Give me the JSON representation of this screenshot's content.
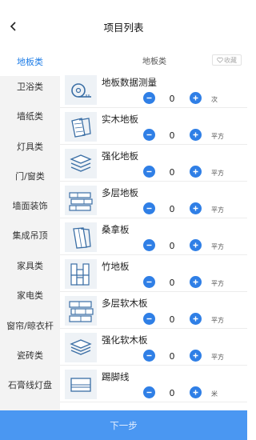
{
  "header": {
    "title": "项目列表"
  },
  "sidebar": {
    "items": [
      {
        "label": "地板类"
      },
      {
        "label": "卫浴类"
      },
      {
        "label": "墙纸类"
      },
      {
        "label": "灯具类"
      },
      {
        "label": "门/窗类"
      },
      {
        "label": "墙面装饰"
      },
      {
        "label": "集成吊顶"
      },
      {
        "label": "家具类"
      },
      {
        "label": "家电类"
      },
      {
        "label": "窗帘/晾衣杆"
      },
      {
        "label": "瓷砖类"
      },
      {
        "label": "石膏线灯盘"
      }
    ]
  },
  "content": {
    "category_title": "地板类",
    "favorite_label": "收藏",
    "items": [
      {
        "name": "地板数据测量",
        "qty": "0",
        "unit": "次",
        "icon": "tape-measure-icon"
      },
      {
        "name": "实木地板",
        "qty": "0",
        "unit": "平方",
        "icon": "solid-wood-floor-icon"
      },
      {
        "name": "强化地板",
        "qty": "0",
        "unit": "平方",
        "icon": "laminate-floor-icon"
      },
      {
        "name": "多层地板",
        "qty": "0",
        "unit": "平方",
        "icon": "multilayer-floor-icon"
      },
      {
        "name": "桑拿板",
        "qty": "0",
        "unit": "平方",
        "icon": "sauna-board-icon"
      },
      {
        "name": "竹地板",
        "qty": "0",
        "unit": "平方",
        "icon": "bamboo-floor-icon"
      },
      {
        "name": "多层软木板",
        "qty": "0",
        "unit": "平方",
        "icon": "multilayer-cork-icon"
      },
      {
        "name": "强化软木板",
        "qty": "0",
        "unit": "平方",
        "icon": "laminate-cork-icon"
      },
      {
        "name": "踢脚线",
        "qty": "0",
        "unit": "米",
        "icon": "skirting-line-icon"
      }
    ]
  },
  "footer": {
    "next_label": "下一步"
  },
  "colors": {
    "accent": "#2f7fe6",
    "footer_bg": "#4a97f2",
    "sidebar_bg": "#f3f3f3",
    "active_text": "#1e7de7"
  }
}
